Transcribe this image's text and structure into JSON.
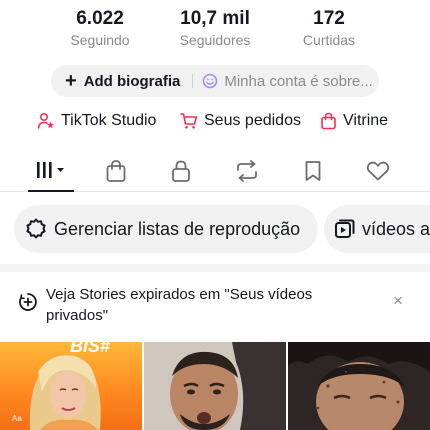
{
  "stats": [
    {
      "value": "6.022",
      "label": "Seguindo"
    },
    {
      "value": "10,7 mil",
      "label": "Seguidores"
    },
    {
      "value": "172",
      "label": "Curtidas"
    }
  ],
  "bio": {
    "add_label": "Add biografia",
    "hint": "Minha conta é sobre..."
  },
  "links": [
    {
      "label": "TikTok Studio",
      "icon": "creator-star-icon"
    },
    {
      "label": "Seus pedidos",
      "icon": "cart-icon"
    },
    {
      "label": "Vitrine",
      "icon": "shopping-bag-icon"
    }
  ],
  "tabs": [
    {
      "icon": "videos-grid-icon",
      "active": true
    },
    {
      "icon": "shop-bag-icon"
    },
    {
      "icon": "lock-icon"
    },
    {
      "icon": "repost-icon"
    },
    {
      "icon": "bookmark-icon"
    },
    {
      "icon": "heart-icon"
    }
  ],
  "chips": [
    {
      "label": "Gerenciar listas de reprodução",
      "icon": "gear-icon"
    },
    {
      "label": "vídeos a",
      "icon": "playlist-icon"
    }
  ],
  "notice": {
    "text": "Veja Stories expirados em \"Seus vídeos privados\"",
    "icon": "story-add-icon",
    "close": "×"
  },
  "thumbnails": [
    {
      "overlay_logo": "BIS#",
      "overlay_small": "Aa"
    },
    {},
    {}
  ],
  "colors": {
    "accent": "#fe2c55",
    "text": "#161823",
    "muted": "#8a8b91",
    "pill_bg": "#f1f1f2"
  }
}
